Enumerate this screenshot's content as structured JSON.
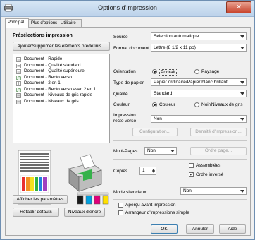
{
  "window": {
    "title": "Options d'impression",
    "close_label": "✕"
  },
  "tabs": [
    "Principal",
    "Plus d'options",
    "Utilitaire"
  ],
  "presets": {
    "heading": "Présélections impression",
    "add_remove_button": "Ajouter/supprimer les éléments prédéfinis...",
    "items": [
      "Document - Rapide",
      "Document - Qualité standard",
      "Document - Qualité supérieure",
      "Document - Recto verso",
      "Document - 2 en 1",
      "Document - Recto verso avec 2 en 1",
      "Document - Niveaux de gris rapide",
      "Document - Niveaux de gris"
    ]
  },
  "left_buttons": {
    "show_settings": "Afficher les paramètres",
    "reset_defaults": "Rétablir défauts",
    "ink_levels": "Niveaux d'encre"
  },
  "settings": {
    "source_label": "Source",
    "source_value": "Sélection automatique",
    "format_label": "Format document",
    "format_value": "Lettre (8 1/2 x 11 po)",
    "orientation_label": "Orientation",
    "orientation_portrait": "Portrait",
    "orientation_landscape": "Paysage",
    "paper_type_label": "Type de papier",
    "paper_type_value": "Papier ordinaire/Papier blanc brillant",
    "quality_label": "Qualité",
    "quality_value": "Standard",
    "color_label": "Couleur",
    "color_option": "Couleur",
    "grayscale_option": "Noir/Niveaux de gris",
    "duplex_label_1": "Impression",
    "duplex_label_2": "recto verso",
    "duplex_value": "Non",
    "configuration_button": "Configuration...",
    "density_button": "Densité d'impression...",
    "multipages_label": "Multi-Pages",
    "multipages_value": "Non",
    "page_order_button": "Ordre page...",
    "copies_label": "Copies",
    "copies_value": "1",
    "collate_label": "Assemblées",
    "reverse_order_label": "Ordre inversé",
    "quiet_mode_label": "Mode silencieux",
    "quiet_mode_value": "Non",
    "preview_label": "Aperçu avant impression",
    "simple_arranger_label": "Arrangeur d'impressions simple"
  },
  "footer": {
    "ok": "OK",
    "cancel": "Annuler",
    "help": "Aide"
  },
  "colors": {
    "title_bar": "#c9dcf0",
    "close": "#c8452d",
    "ink": [
      "#1a1a1a",
      "#00a0e0",
      "#e0007a",
      "#ffe000"
    ]
  },
  "icons": [
    "printer-icon",
    "paper-preview-icon",
    "document-icon"
  ]
}
